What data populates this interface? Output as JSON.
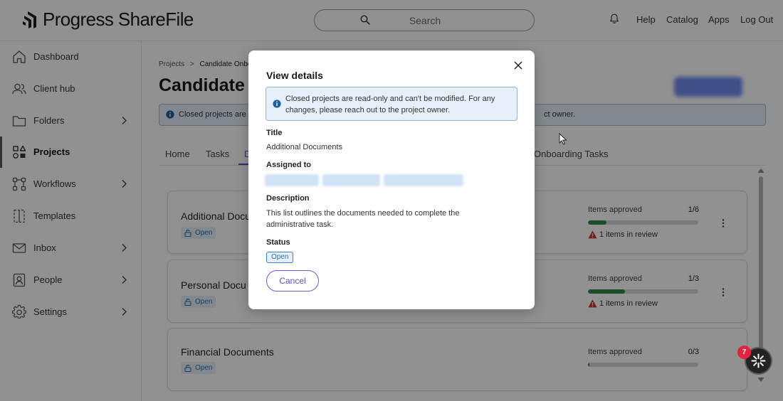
{
  "header": {
    "logo_text": "Progress ShareFile",
    "search_placeholder": "Search",
    "nav": [
      {
        "label": "Help"
      },
      {
        "label": "Catalog"
      },
      {
        "label": "Apps"
      },
      {
        "label": "Log Out"
      }
    ]
  },
  "sidebar": {
    "items": [
      {
        "label": "Dashboard",
        "icon": "home-icon"
      },
      {
        "label": "Client hub",
        "icon": "users-icon"
      },
      {
        "label": "Folders",
        "icon": "folder-icon",
        "has_submenu": true
      },
      {
        "label": "Projects",
        "icon": "projects-icon",
        "active": true
      },
      {
        "label": "Workflows",
        "icon": "workflow-icon",
        "has_submenu": true
      },
      {
        "label": "Templates",
        "icon": "template-icon"
      },
      {
        "label": "Inbox",
        "icon": "inbox-icon",
        "has_submenu": true
      },
      {
        "label": "People",
        "icon": "person-icon",
        "has_submenu": true
      },
      {
        "label": "Settings",
        "icon": "gear-icon",
        "has_submenu": true
      }
    ]
  },
  "main": {
    "breadcrumb": {
      "root": "Projects",
      "separator": ">",
      "current": "Candidate Onbo"
    },
    "title": "Candidate C",
    "banner": {
      "text": "Closed projects are",
      "text_tail": "ct owner."
    },
    "tabs": [
      {
        "label": "Home"
      },
      {
        "label": "Tasks"
      },
      {
        "label": "D",
        "active": true
      },
      {
        "label": "Onboarding Tasks"
      }
    ],
    "cards": [
      {
        "title": "Additional Docu",
        "badge": "Open",
        "approved_label": "Items approved",
        "approved_count": "1/6",
        "progress": 0.167,
        "review_text": "1 items in review"
      },
      {
        "title": "Personal Docu",
        "badge": "Open",
        "approved_label": "Items approved",
        "approved_count": "1/3",
        "progress": 0.333,
        "review_text": "1 items in review"
      },
      {
        "title": "Financial Documents",
        "badge": "Open",
        "approved_label": "Items approved",
        "approved_count": "0/3",
        "progress": 0.0
      }
    ]
  },
  "modal": {
    "title": "View details",
    "banner_text": "Closed projects are read-only and can't be modified. For any changes, please reach out to the project owner.",
    "title_label": "Title",
    "title_value": "Additional Documents",
    "assigned_label": "Assigned to",
    "description_label": "Description",
    "description_value": "This list outlines the documents needed to complete the administrative task.",
    "status_label": "Status",
    "status_value": "Open",
    "cancel_label": "Cancel"
  },
  "assistant": {
    "badge_count": "7"
  },
  "colors": {
    "accent": "#5b4fd0",
    "info_bg": "#e5f0fa",
    "info_border": "#8fb4d4",
    "progress": "#2f8a47",
    "warning": "#d9302c",
    "notification": "#e0243b"
  }
}
